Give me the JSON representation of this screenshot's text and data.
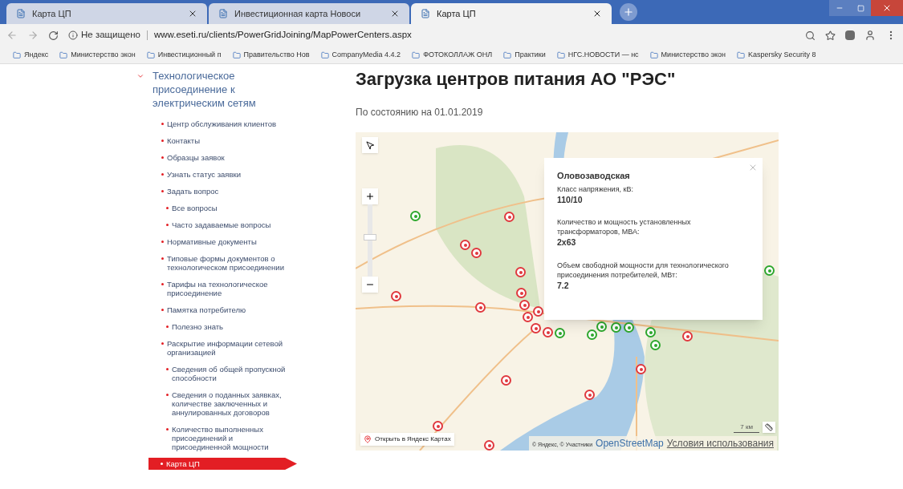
{
  "browser": {
    "tabs": [
      {
        "title": "Карта ЦП",
        "selected": false
      },
      {
        "title": "Инвестиционная карта Новоси",
        "selected": false
      },
      {
        "title": "Карта ЦП",
        "selected": true
      }
    ],
    "security": "Не защищено",
    "url": "www.eseti.ru/clients/PowerGridJoining/MapPowerCenters.aspx",
    "bookmarks": [
      "Яндекс",
      "Министерство экон",
      "Инвестиционный п",
      "Правительство Нов",
      "CompanyMedia 4.4.2",
      "ФОТОКОЛЛАЖ ОНЛ",
      "Практики",
      "НГС.НОВОСТИ — нс",
      "Министерство экон",
      "Kaspersky Security 8"
    ]
  },
  "sidebar": {
    "title": "Технологическое присоединение к электрическим сетям",
    "expanded": true,
    "items": [
      {
        "label": "Центр обслуживания клиентов",
        "selected": false
      },
      {
        "label": "Контакты",
        "selected": false
      },
      {
        "label": "Образцы заявок",
        "selected": false
      },
      {
        "label": "Узнать статус заявки",
        "selected": false
      },
      {
        "label": "Задать вопрос",
        "selected": false,
        "children": [
          {
            "label": "Все вопросы",
            "selected": false
          },
          {
            "label": "Часто задаваемые вопросы",
            "selected": false
          }
        ]
      },
      {
        "label": "Нормативные документы",
        "selected": false
      },
      {
        "label": "Типовые формы документов о технологическом присоединении",
        "selected": false
      },
      {
        "label": "Тарифы на технологическое присоединение",
        "selected": false
      },
      {
        "label": "Памятка потребителю",
        "selected": false,
        "children": [
          {
            "label": "Полезно знать",
            "selected": false
          }
        ]
      },
      {
        "label": "Раскрытие информации сетевой организацией",
        "selected": false,
        "children": [
          {
            "label": "Сведения об общей пропускной способности",
            "selected": false
          },
          {
            "label": "Сведения о поданных заявках, количестве заключенных и аннулированных договоров",
            "selected": false
          },
          {
            "label": "Количество выполненных присоединений и присоединенной мощности",
            "selected": false
          }
        ]
      },
      {
        "label": "Карта ЦП",
        "selected": true
      }
    ]
  },
  "page": {
    "title": "Загрузка центров питания АО \"РЭС\"",
    "date": "По состоянию на 01.01.2019"
  },
  "map": {
    "markers": [
      {
        "color": "#2ea82e"
      },
      {
        "color": "#e0383e"
      },
      {
        "color": "#e0383e"
      },
      {
        "color": "#e0383e"
      },
      {
        "color": "#e0383e"
      },
      {
        "color": "#e0383e"
      },
      {
        "color": "#e0383e"
      },
      {
        "color": "#e0383e"
      },
      {
        "color": "#e0383e"
      },
      {
        "color": "#e0383e"
      },
      {
        "color": "#e0383e"
      },
      {
        "color": "#e0383e"
      },
      {
        "color": "#2ea82e"
      },
      {
        "color": "#e0383e"
      },
      {
        "color": "#2ea82e"
      },
      {
        "color": "#2ea82e"
      },
      {
        "color": "#2ea82e"
      },
      {
        "color": "#2ea82e"
      },
      {
        "color": "#2ea82e"
      },
      {
        "color": "#2ea82e"
      },
      {
        "color": "#e0383e"
      },
      {
        "color": "#e0383e"
      },
      {
        "color": "#e0383e"
      },
      {
        "color": "#e0383e"
      },
      {
        "color": "#e0383e"
      },
      {
        "color": "#e0383e"
      },
      {
        "color": "#2ea82e"
      }
    ],
    "popup": {
      "title": "Оловозаводская",
      "fields": [
        {
          "label": "Класс напряжения, кВ:",
          "value": "110/10"
        },
        {
          "label": "Количество и мощность установленных трансформаторов, МВА:",
          "value": "2x63"
        },
        {
          "label": "Объем свободной мощности для технологического присоединения потребителей, МВт:",
          "value": "7.2"
        }
      ]
    },
    "zoom": {
      "level": 0.55
    },
    "open_link": "Открыть в Яндекс Картах",
    "scale": "7 км",
    "attribution": "© Яндекс, © Участники",
    "osm_link": "OpenStreetMap",
    "terms_link": "Условия использования"
  }
}
